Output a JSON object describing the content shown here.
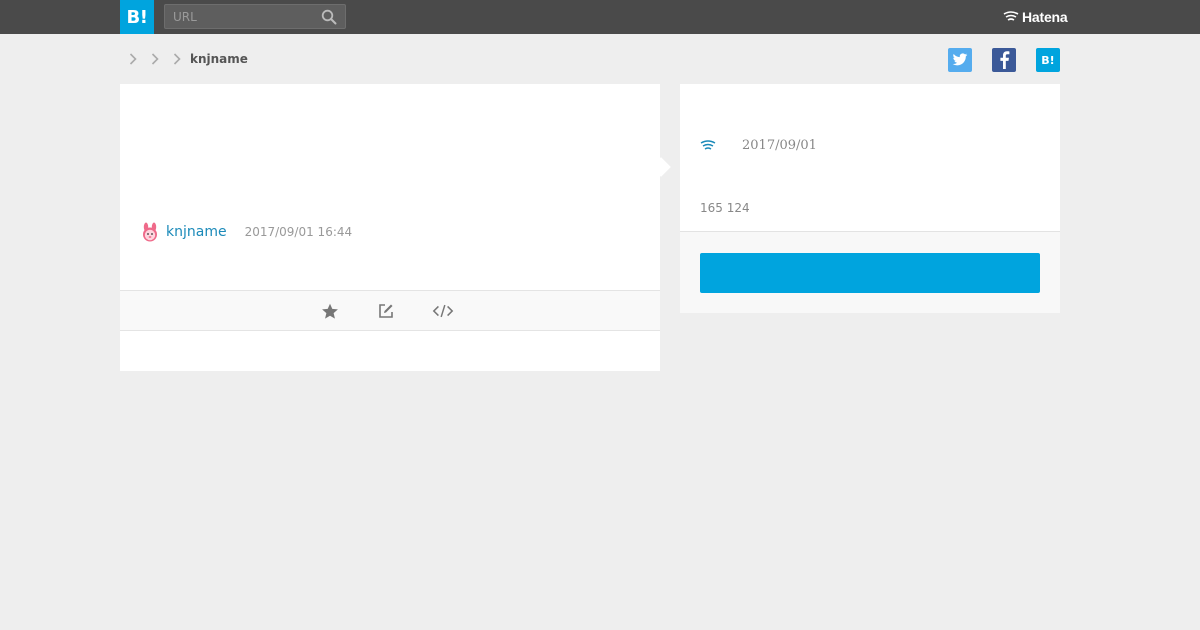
{
  "header": {
    "logo_text": "B!",
    "search": {
      "placeholder": "URL",
      "value": ""
    },
    "brand_text": "Hatena"
  },
  "breadcrumb": {
    "current": "knjname"
  },
  "share": {
    "twitter_icon": "twitter-icon",
    "facebook_icon": "facebook-icon",
    "hatena_label": "B!"
  },
  "entry": {
    "user_name": "knjname",
    "timestamp": "2017/09/01 16:44"
  },
  "sidebar": {
    "date": "2017/09/01",
    "counts": "165 124"
  },
  "colors": {
    "accent": "#00a4de",
    "header_bg": "#4a4a4a",
    "link": "#1b8ab9"
  }
}
